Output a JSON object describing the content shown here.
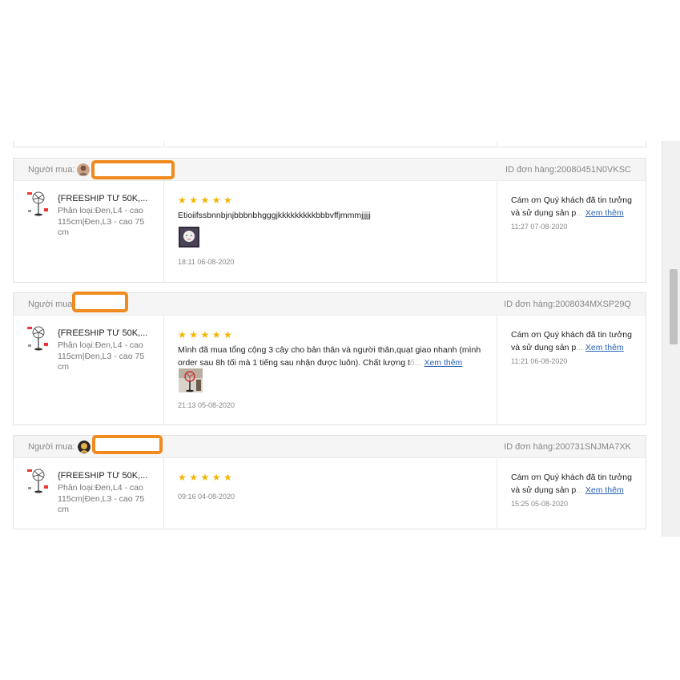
{
  "buyer_label": "Người mua:",
  "stars": "★★★★★",
  "read_more": "Xem thêm",
  "reviews": [
    {
      "order_id": "ID đơn hàng:20080451N0VKSC",
      "product_name": "{FREESHIP TỪ 50K,...",
      "variant": "Phân loại:Đen,L4 - cao 115cm|Đen,L3 - cao 75 cm",
      "text": "Etioiifssbnnbjnjbbbnbhgggjkkkkkkkkkbbbvffjmmmjjjjj",
      "review_time": "18:11 06-08-2020",
      "reply_text": "Cám ơn Quý khách đã tin tưởng và sử dụng sản p",
      "reply_fade": "...",
      "reply_time": "11:27 07-08-2020"
    },
    {
      "order_id": "ID đơn hàng:2008034MXSP29Q",
      "product_name": "{FREESHIP TỪ 50K,...",
      "variant": "Phân loại:Đen,L4 - cao 115cm|Đen,L3 - cao 75 cm",
      "text": "Mình đã mua tổng cộng 3 cây cho bản thân và người thân,quạt giao nhanh (mình order sau 8h tối mà 1 tiếng sau nhận được luôn). Chất lượng t",
      "text_fade": "ố...",
      "review_time": "21:13 05-08-2020",
      "reply_text": "Cám ơn Quý khách đã tin tưởng và sử dụng sản p",
      "reply_fade": "...",
      "reply_time": "11:21 06-08-2020"
    },
    {
      "order_id": "ID đơn hàng:200731SNJMA7XK",
      "product_name": "{FREESHIP TỪ 50K,...",
      "variant": "Phân loại:Đen,L4 - cao 115cm|Đen,L3 - cao 75 cm",
      "review_time": "09:16 04-08-2020",
      "reply_text": "Cám ơn Quý khách đã tin tưởng và sử dụng sản p",
      "reply_fade": "...",
      "reply_time": "15:25 05-08-2020"
    }
  ],
  "colors": {
    "star": "#f5b400",
    "link": "#2a62b5",
    "redaction": "#f08a1c"
  }
}
